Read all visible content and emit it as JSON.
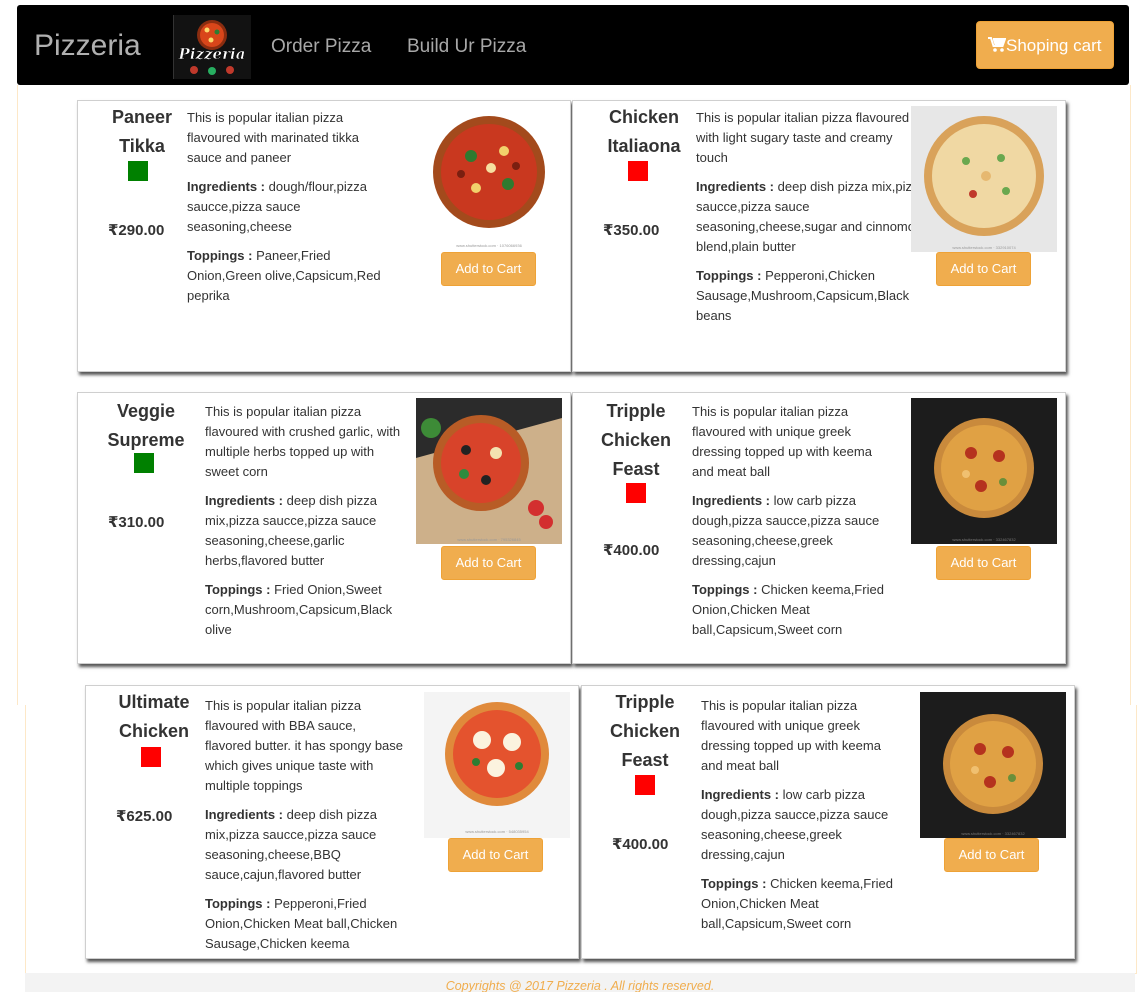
{
  "navbar": {
    "brand": "Pizzeria",
    "logo_text": "Pizzeria",
    "links": [
      "Order Pizza",
      "Build Ur Pizza"
    ],
    "cart_label": "Shoping cart"
  },
  "colors": {
    "accent": "#f0ad4e",
    "veg": "#008000",
    "nonveg": "#ff0000",
    "navbar": "#000000"
  },
  "labels": {
    "ingredients": "Ingredients :",
    "toppings": "Toppings :",
    "add_to_cart": "Add to Cart"
  },
  "pizzas": [
    {
      "name_lines": [
        "Paneer",
        "Tikka"
      ],
      "diet": "veg",
      "price": "₹290.00",
      "description": "This is popular italian pizza flavoured with marinated tikka sauce and paneer",
      "ingredients": "dough/flour,pizza saucce,pizza sauce seasoning,cheese",
      "toppings": "Paneer,Fried Onion,Green olive,Capsicum,Red peprika"
    },
    {
      "name_lines": [
        "Chicken",
        "Italiaona"
      ],
      "diet": "nonveg",
      "price": "₹350.00",
      "description": "This is popular italian pizza flavoured with light sugary taste and creamy touch",
      "ingredients": "deep dish pizza mix,pizza saucce,pizza sauce seasoning,cheese,sugar and cinnomon blend,plain butter",
      "toppings": "Pepperoni,Chicken Sausage,Mushroom,Capsicum,Black beans"
    },
    {
      "name_lines": [
        "Veggie",
        "Supreme"
      ],
      "diet": "veg",
      "price": "₹310.00",
      "description": "This is popular italian pizza flavoured with crushed garlic, with multiple herbs topped up with sweet corn",
      "ingredients": "deep dish pizza mix,pizza saucce,pizza sauce seasoning,cheese,garlic herbs,flavored butter",
      "toppings": "Fried Onion,Sweet corn,Mushroom,Capsicum,Black olive"
    },
    {
      "name_lines": [
        "Tripple",
        "Chicken",
        "Feast"
      ],
      "diet": "nonveg",
      "price": "₹400.00",
      "description": "This is popular italian pizza flavoured with unique greek dressing topped up with keema and meat ball",
      "ingredients": "low carb pizza dough,pizza saucce,pizza sauce seasoning,cheese,greek dressing,cajun",
      "toppings": "Chicken keema,Fried Onion,Chicken Meat ball,Capsicum,Sweet corn"
    },
    {
      "name_lines": [
        "Ultimate",
        "Chicken"
      ],
      "diet": "nonveg",
      "price": "₹625.00",
      "description": "This is popular italian pizza flavoured with BBA sauce, flavored butter. it has spongy base which gives unique taste with multiple toppings",
      "ingredients": "deep dish pizza mix,pizza saucce,pizza sauce seasoning,cheese,BBQ sauce,cajun,flavored butter",
      "toppings": "Pepperoni,Fried Onion,Chicken Meat ball,Chicken Sausage,Chicken keema"
    },
    {
      "name_lines": [
        "Tripple",
        "Chicken",
        "Feast"
      ],
      "diet": "nonveg",
      "price": "₹400.00",
      "description": "This is popular italian pizza flavoured with unique greek dressing topped up with keema and meat ball",
      "ingredients": "low carb pizza dough,pizza saucce,pizza sauce seasoning,cheese,greek dressing,cajun",
      "toppings": "Chicken keema,Fried Onion,Chicken Meat ball,Capsicum,Sweet corn"
    }
  ],
  "footer": {
    "text": "Copyrights @ 2017 Pizzeria . All rights reserved."
  }
}
